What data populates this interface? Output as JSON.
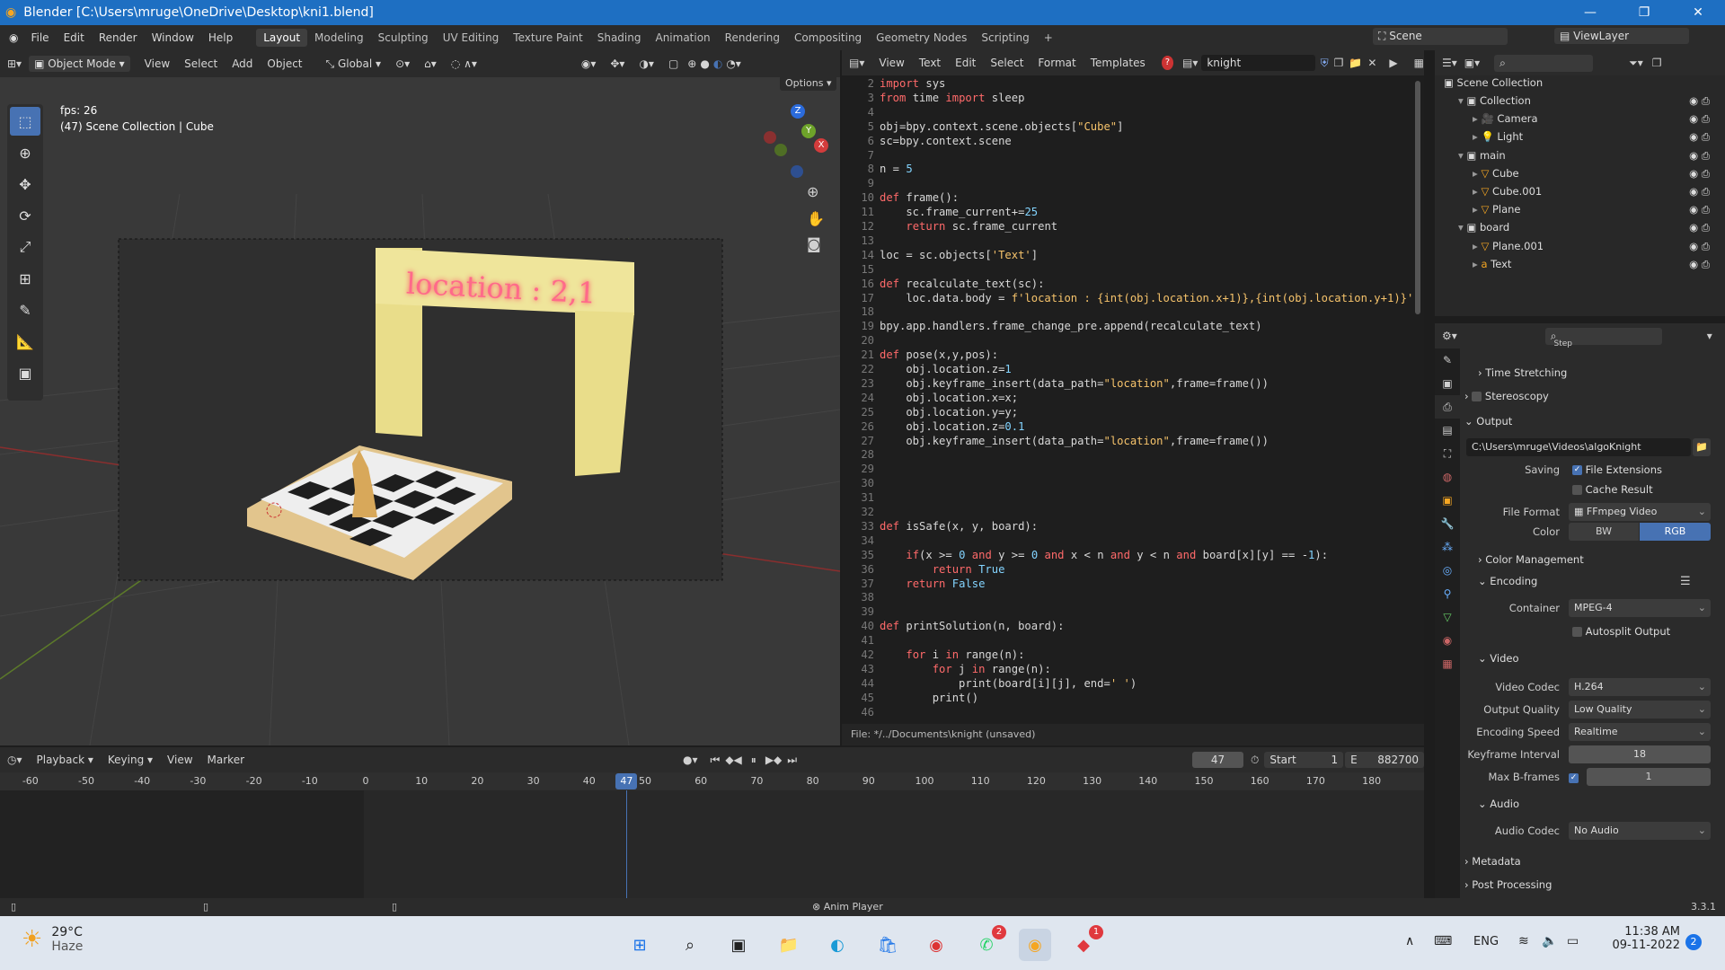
{
  "window": {
    "title": "Blender [C:\\Users\\mruge\\OneDrive\\Desktop\\kni1.blend]",
    "minimize": "—",
    "maximize": "❐",
    "close": "✕"
  },
  "menu": {
    "items": [
      "File",
      "Edit",
      "Render",
      "Window",
      "Help"
    ]
  },
  "workspaces": [
    "Layout",
    "Modeling",
    "Sculpting",
    "UV Editing",
    "Texture Paint",
    "Shading",
    "Animation",
    "Rendering",
    "Compositing",
    "Geometry Nodes",
    "Scripting",
    "+"
  ],
  "workspace_active": "Layout",
  "scene": {
    "name": "Scene",
    "view_layer": "ViewLayer"
  },
  "viewport": {
    "mode": "Object Mode",
    "menus": [
      "View",
      "Select",
      "Add",
      "Object"
    ],
    "transform": "Global",
    "options": "Options",
    "fps": "fps: 26",
    "info": "(47) Scene Collection | Cube",
    "sign_text": "location : 2,1",
    "gizmo": {
      "z": "Z",
      "y": "Y",
      "x": "X"
    }
  },
  "text_editor": {
    "menus": [
      "View",
      "Text",
      "Edit",
      "Select",
      "Format",
      "Templates"
    ],
    "file_name": "knight",
    "footer": "File: */../Documents\\knight (unsaved)",
    "lines": [
      {
        "n": "2",
        "html": "<span class='kw'>import</span> sys"
      },
      {
        "n": "3",
        "html": "<span class='kw'>from</span> time <span class='kw'>import</span> sleep"
      },
      {
        "n": "4",
        "html": ""
      },
      {
        "n": "5",
        "html": "obj=bpy.context.scene.objects[<span class='st'>\"Cube\"</span>]"
      },
      {
        "n": "6",
        "html": "sc=bpy.context.scene"
      },
      {
        "n": "7",
        "html": ""
      },
      {
        "n": "8",
        "html": "n = <span class='nm'>5</span>"
      },
      {
        "n": "9",
        "html": ""
      },
      {
        "n": "10",
        "html": "<span class='kw'>def</span> frame():"
      },
      {
        "n": "11",
        "html": "    sc.frame_current+=<span class='nm'>25</span>"
      },
      {
        "n": "12",
        "html": "    <span class='kw'>return</span> sc.frame_current"
      },
      {
        "n": "13",
        "html": ""
      },
      {
        "n": "14",
        "html": "loc = sc.objects[<span class='st'>'Text'</span>]"
      },
      {
        "n": "15",
        "html": ""
      },
      {
        "n": "16",
        "html": "<span class='kw'>def</span> recalculate_text(sc):"
      },
      {
        "n": "17",
        "html": "    loc.data.body = <span class='st'>f'location : {int(obj.location.x+1)},{int(obj.location.y+1)}'</span>"
      },
      {
        "n": "18",
        "html": ""
      },
      {
        "n": "19",
        "html": "bpy.app.handlers.frame_change_pre.append(recalculate_text)"
      },
      {
        "n": "20",
        "html": ""
      },
      {
        "n": "21",
        "html": "<span class='kw'>def</span> pose(x,y,pos):"
      },
      {
        "n": "22",
        "html": "    obj.location.z=<span class='nm'>1</span>"
      },
      {
        "n": "23",
        "html": "    obj.keyframe_insert(data_path=<span class='st'>\"location\"</span>,frame=frame())"
      },
      {
        "n": "24",
        "html": "    obj.location.x=x;"
      },
      {
        "n": "25",
        "html": "    obj.location.y=y;"
      },
      {
        "n": "26",
        "html": "    obj.location.z=<span class='nm'>0.1</span>"
      },
      {
        "n": "27",
        "html": "    obj.keyframe_insert(data_path=<span class='st'>\"location\"</span>,frame=frame())"
      },
      {
        "n": "28",
        "html": ""
      },
      {
        "n": "29",
        "html": ""
      },
      {
        "n": "30",
        "html": ""
      },
      {
        "n": "31",
        "html": ""
      },
      {
        "n": "32",
        "html": ""
      },
      {
        "n": "33",
        "html": "<span class='kw'>def</span> isSafe(x, y, board):"
      },
      {
        "n": "34",
        "html": ""
      },
      {
        "n": "35",
        "html": "    <span class='kw'>if</span>(x >= <span class='nm'>0</span> <span class='kw'>and</span> y >= <span class='nm'>0</span> <span class='kw'>and</span> x < n <span class='kw'>and</span> y < n <span class='kw'>and</span> board[x][y] == -<span class='nm'>1</span>):"
      },
      {
        "n": "36",
        "html": "        <span class='kw'>return</span> <span class='nm'>True</span>"
      },
      {
        "n": "37",
        "html": "    <span class='kw'>return</span> <span class='nm'>False</span>"
      },
      {
        "n": "38",
        "html": ""
      },
      {
        "n": "39",
        "html": ""
      },
      {
        "n": "40",
        "html": "<span class='kw'>def</span> printSolution(n, board):"
      },
      {
        "n": "41",
        "html": ""
      },
      {
        "n": "42",
        "html": "    <span class='kw'>for</span> i <span class='kw'>in</span> range(n):"
      },
      {
        "n": "43",
        "html": "        <span class='kw'>for</span> j <span class='kw'>in</span> range(n):"
      },
      {
        "n": "44",
        "html": "            print(board[i][j], end=<span class='st'>' '</span>)"
      },
      {
        "n": "45",
        "html": "        print()"
      },
      {
        "n": "46",
        "html": ""
      }
    ]
  },
  "outliner": {
    "root": "Scene Collection",
    "rows": [
      {
        "label": "Collection",
        "indent": 1,
        "icon": "collection"
      },
      {
        "label": "Camera",
        "indent": 2,
        "icon": "camera"
      },
      {
        "label": "Light",
        "indent": 2,
        "icon": "light"
      },
      {
        "label": "main",
        "indent": 1,
        "icon": "collection"
      },
      {
        "label": "Cube",
        "indent": 2,
        "icon": "mesh"
      },
      {
        "label": "Cube.001",
        "indent": 2,
        "icon": "mesh"
      },
      {
        "label": "Plane",
        "indent": 2,
        "icon": "mesh"
      },
      {
        "label": "board",
        "indent": 1,
        "icon": "collection"
      },
      {
        "label": "Plane.001",
        "indent": 2,
        "icon": "mesh"
      },
      {
        "label": "Text",
        "indent": 2,
        "icon": "text"
      }
    ]
  },
  "properties": {
    "time_stretching": "Time Stretching",
    "stereoscopy": "Stereoscopy",
    "output": "Output",
    "path": "C:\\Users\\mruge\\Videos\\algoKnight",
    "saving": "Saving",
    "file_extensions": "File Extensions",
    "cache_result": "Cache Result",
    "file_format_label": "File Format",
    "file_format": "FFmpeg Video",
    "color_label": "Color",
    "color_bw": "BW",
    "color_rgb": "RGB",
    "color_management": "Color Management",
    "encoding": "Encoding",
    "container_label": "Container",
    "container": "MPEG-4",
    "autosplit": "Autosplit Output",
    "video": "Video",
    "video_codec_label": "Video Codec",
    "video_codec": "H.264",
    "output_quality_label": "Output Quality",
    "output_quality": "Low Quality",
    "encoding_speed_label": "Encoding Speed",
    "encoding_speed": "Realtime",
    "keyframe_interval_label": "Keyframe Interval",
    "keyframe_interval": "18",
    "max_bframes_label": "Max B-frames",
    "max_bframes": "1",
    "audio": "Audio",
    "audio_codec_label": "Audio Codec",
    "audio_codec": "No Audio",
    "metadata": "Metadata",
    "post_processing": "Post Processing",
    "step": "Step"
  },
  "timeline": {
    "menus": [
      "Playback",
      "Keying",
      "View",
      "Marker"
    ],
    "current_frame": "47",
    "start_label": "Start",
    "start": "1",
    "end_label": "E",
    "end": "882700",
    "ticks": [
      "-60",
      "-50",
      "-40",
      "-30",
      "-20",
      "-10",
      "0",
      "10",
      "20",
      "30",
      "40",
      "50",
      "60",
      "70",
      "80",
      "90",
      "100",
      "110",
      "120",
      "130",
      "140",
      "150",
      "160",
      "170",
      "180"
    ],
    "playhead": "47"
  },
  "status": {
    "center": "Anim Player",
    "version": "3.3.1"
  },
  "taskbar": {
    "weather_temp": "29°C",
    "weather_desc": "Haze",
    "lang": "ENG",
    "time": "11:38 AM",
    "date": "09-11-2022",
    "notif": "2",
    "whatsapp_badge": "2",
    "app_badge": "1"
  }
}
